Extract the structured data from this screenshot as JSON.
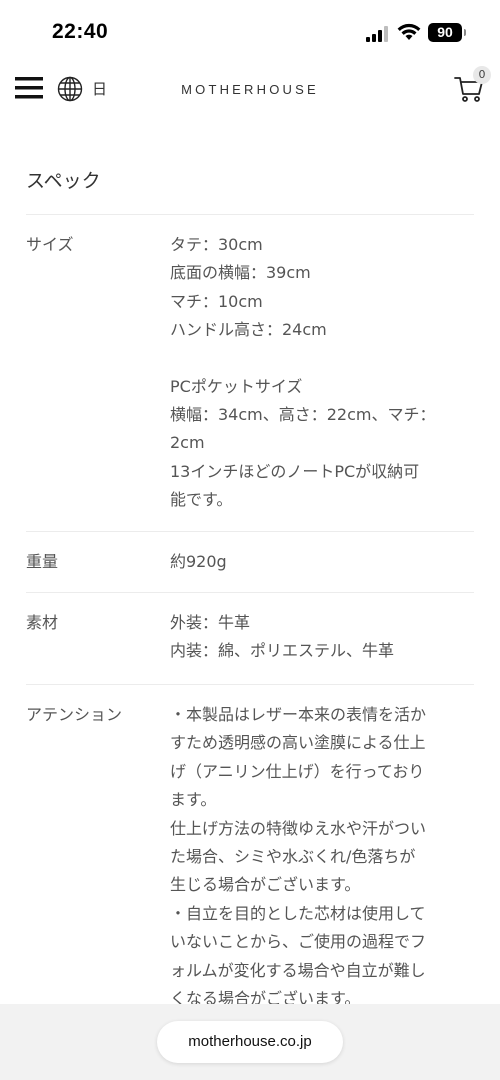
{
  "status_bar": {
    "time": "22:40",
    "battery": "90",
    "icons": [
      "signal-icon",
      "wifi-icon",
      "battery-icon"
    ]
  },
  "header": {
    "menu_icon": "hamburger-menu-icon",
    "globe_icon": "globe-icon",
    "language": "日",
    "logo": "MOTHERHOUSE",
    "cart_icon": "cart-icon",
    "cart_count": "0"
  },
  "specs": {
    "title": "スペック",
    "rows": [
      {
        "label": "サイズ",
        "lines": [
          "タテ：30cm",
          "底面の横幅：39cm",
          "マチ：10cm",
          "ハンドル高さ：24cm",
          "",
          "PCポケットサイズ",
          "横幅：34cm、高さ：22cm、マチ：",
          "2cm",
          "13インチほどのノートPCが収納可",
          "能です。"
        ]
      },
      {
        "label": "重量",
        "lines": [
          "約920g"
        ]
      },
      {
        "label": "素材",
        "lines": [
          "外装：牛革",
          "内装：綿、ポリエステル、牛革"
        ]
      },
      {
        "label": "アテンション",
        "lines": [
          "・本製品はレザー本来の表情を活か",
          "すため透明感の高い塗膜による仕上",
          "げ（アニリン仕上げ）を行っており",
          "ます。",
          "仕上げ方法の特徴ゆえ水や汗がつい",
          "た場合、シミや水ぶくれ/色落ちが",
          "生じる場合がございます。",
          "・自立を目的とした芯材は使用して",
          "いないことから、ご使用の過程でフ",
          "ォルムが変化する場合や自立が難し",
          "くなる場合がございます。"
        ]
      }
    ]
  },
  "browser": {
    "url": "motherhouse.co.jp"
  }
}
